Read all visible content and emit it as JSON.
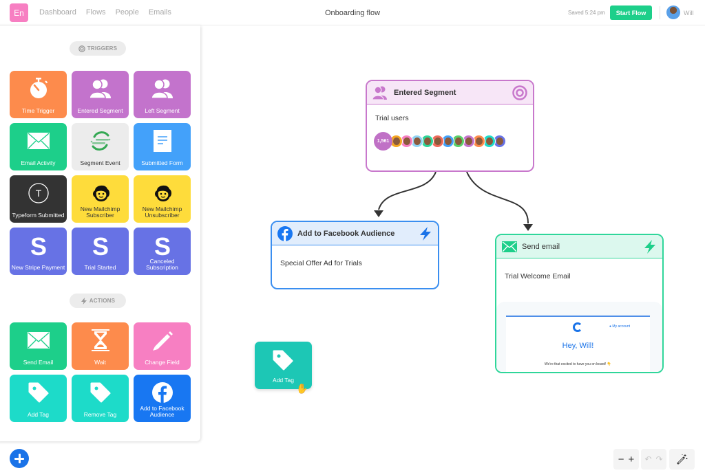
{
  "topbar": {
    "logo": "En",
    "nav": [
      "Dashboard",
      "Flows",
      "People",
      "Emails"
    ],
    "title": "Onboarding flow",
    "saved_status": "Saved 5:24 pm",
    "start_button": "Start Flow",
    "user_name": "Will"
  },
  "sidebar": {
    "triggers_label": "TRIGGERS",
    "actions_label": "ACTIONS",
    "triggers": [
      {
        "label": "Time Trigger",
        "icon": "stopwatch-icon",
        "color": "#fd8b4c"
      },
      {
        "label": "Entered Segment",
        "icon": "users-icon",
        "color": "#c373cc"
      },
      {
        "label": "Left Segment",
        "icon": "users-icon",
        "color": "#c373cc"
      },
      {
        "label": "Email Activity",
        "icon": "envelope-icon",
        "color": "#1dcf8a"
      },
      {
        "label": "Segment Event",
        "icon": "segment-logo-icon",
        "color": "#ececec"
      },
      {
        "label": "Submitted Form",
        "icon": "document-icon",
        "color": "#43a1fa"
      },
      {
        "label": "Typeform Submitted",
        "icon": "typeform-icon",
        "color": "#333333"
      },
      {
        "label": "New Mailchimp Subscriber",
        "icon": "mailchimp-icon",
        "color": "#fedc3b"
      },
      {
        "label": "New Mailchimp Unsubscriber",
        "icon": "mailchimp-icon",
        "color": "#fedc3b"
      },
      {
        "label": "New Stripe Payment",
        "icon": "stripe-icon",
        "color": "#6772e5"
      },
      {
        "label": "Trial Started",
        "icon": "stripe-icon",
        "color": "#6772e5"
      },
      {
        "label": "Canceled Subscription",
        "icon": "stripe-icon",
        "color": "#6772e5"
      }
    ],
    "actions": [
      {
        "label": "Send Email",
        "icon": "envelope-icon",
        "color": "#1dcf8a"
      },
      {
        "label": "Wait",
        "icon": "hourglass-icon",
        "color": "#fd8b4c"
      },
      {
        "label": "Change Field",
        "icon": "pencil-icon",
        "color": "#f77fc2"
      },
      {
        "label": "Add Tag",
        "icon": "tag-icon",
        "color": "#1ddbc9"
      },
      {
        "label": "Remove Tag",
        "icon": "tag-icon",
        "color": "#1ddbc9"
      },
      {
        "label": "Add to Facebook Audience",
        "icon": "facebook-icon",
        "color": "#1877f2"
      }
    ]
  },
  "canvas": {
    "segment_node": {
      "title": "Entered Segment",
      "segment_name": "Trial users",
      "member_count": "1,561",
      "avatar_colors": [
        "#f5a623",
        "#f77fc2",
        "#8fd3f4",
        "#2fd69a",
        "#ee6b5b",
        "#43a1fa",
        "#5ad06b",
        "#c373cc",
        "#fd8b4c",
        "#1ddbc9",
        "#6772e5"
      ]
    },
    "facebook_node": {
      "title": "Add to Facebook Audience",
      "audience_name": "Special Offer Ad for Trials"
    },
    "email_node": {
      "title": "Send email",
      "email_name": "Trial Welcome Email",
      "preview": {
        "account_link": "My account",
        "greeting": "Hey, Will!",
        "subtext": "We're that excited to have you on board! 👇"
      }
    },
    "dragging_tile": {
      "label": "Add Tag",
      "icon": "tag-icon"
    }
  },
  "toolbar": {
    "zoom_out": "−",
    "zoom_in": "+",
    "undo": "↶",
    "redo": "↷"
  }
}
